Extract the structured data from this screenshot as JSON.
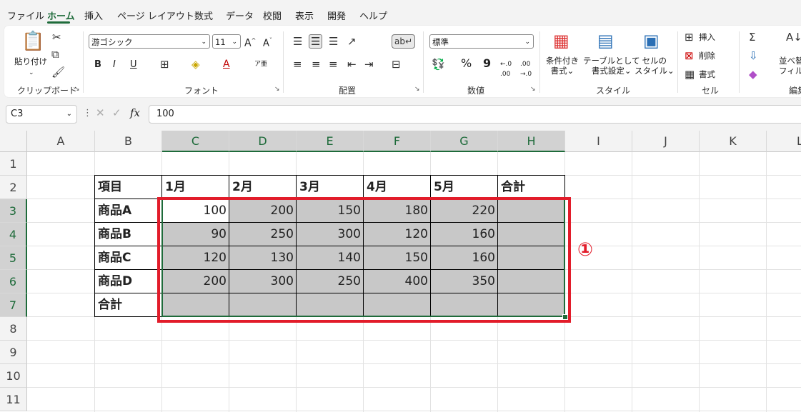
{
  "menu": {
    "items": [
      "ファイル",
      "ホーム",
      "挿入",
      "ページ レイアウト",
      "数式",
      "データ",
      "校閲",
      "表示",
      "開発",
      "ヘルプ"
    ],
    "active_index": 1
  },
  "ribbon": {
    "clipboard": {
      "paste_label": "貼り付け",
      "group_label": "クリップボード"
    },
    "font": {
      "font_name": "游ゴシック",
      "font_size": "11",
      "bold": "B",
      "italic": "I",
      "underline": "U",
      "group_label": "フォント"
    },
    "alignment": {
      "group_label": "配置"
    },
    "number": {
      "format": "標準",
      "percent": "%",
      "comma": "9",
      "group_label": "数値"
    },
    "styles": {
      "conditional": "条件付き\n書式",
      "conditional_line1": "条件付き",
      "conditional_line2": "書式",
      "table_line1": "テーブルとして",
      "table_line2": "書式設定",
      "cell_line1": "セルの",
      "cell_line2": "スタイル",
      "group_label": "スタイル"
    },
    "cells": {
      "insert": "挿入",
      "delete": "削除",
      "format": "書式",
      "group_label": "セル"
    },
    "editing": {
      "sort_label": "並べ替",
      "sort_label2": "フィルタ",
      "group_label": "編集"
    }
  },
  "formula_bar": {
    "name_box": "C3",
    "fx": "fx",
    "value": "100"
  },
  "sheet": {
    "columns": [
      "A",
      "B",
      "C",
      "D",
      "E",
      "F",
      "G",
      "H",
      "I",
      "J",
      "K",
      "L"
    ],
    "rows": [
      "1",
      "2",
      "3",
      "4",
      "5",
      "6",
      "7",
      "8",
      "9",
      "10",
      "11"
    ],
    "headers": [
      "項目",
      "1月",
      "2月",
      "3月",
      "4月",
      "5月",
      "合計"
    ],
    "data_rows": [
      {
        "label": "商品A",
        "values": [
          "100",
          "200",
          "150",
          "180",
          "220",
          ""
        ]
      },
      {
        "label": "商品B",
        "values": [
          "90",
          "250",
          "300",
          "120",
          "160",
          ""
        ]
      },
      {
        "label": "商品C",
        "values": [
          "120",
          "130",
          "140",
          "150",
          "160",
          ""
        ]
      },
      {
        "label": "商品D",
        "values": [
          "200",
          "300",
          "250",
          "400",
          "350",
          ""
        ]
      },
      {
        "label": "合計",
        "values": [
          "",
          "",
          "",
          "",
          "",
          ""
        ]
      }
    ]
  },
  "annotation": {
    "callout": "①",
    "color": "#e21c2a"
  },
  "colors": {
    "accent": "#1e6b3a",
    "selection": "#c8c8c8"
  }
}
